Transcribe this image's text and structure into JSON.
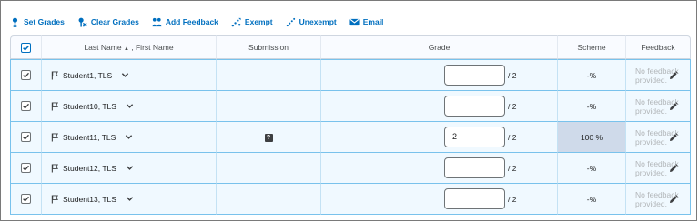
{
  "toolbar": {
    "set_grades": "Set Grades",
    "clear_grades": "Clear Grades",
    "add_feedback": "Add Feedback",
    "exempt": "Exempt",
    "unexempt": "Unexempt",
    "email": "Email"
  },
  "table": {
    "headers": {
      "name_prefix": "Last Name",
      "sort_arrow": "▲",
      "name_suffix": ", First Name",
      "submission": "Submission",
      "grade": "Grade",
      "scheme": "Scheme",
      "feedback": "Feedback"
    },
    "rows": [
      {
        "name": "Student1, TLS",
        "grade": "",
        "out_of": "/ 2",
        "scheme": "-%",
        "feedback": "No feedback provided.",
        "has_submission": false
      },
      {
        "name": "Student10, TLS",
        "grade": "",
        "out_of": "/ 2",
        "scheme": "-%",
        "feedback": "No feedback provided.",
        "has_submission": false
      },
      {
        "name": "Student11, TLS",
        "grade": "2",
        "out_of": "/ 2",
        "scheme": "100 %",
        "feedback": "No feedback provided.",
        "has_submission": true,
        "submission_icon": "?"
      },
      {
        "name": "Student12, TLS",
        "grade": "",
        "out_of": "/ 2",
        "scheme": "-%",
        "feedback": "No feedback provided.",
        "has_submission": false
      },
      {
        "name": "Student13, TLS",
        "grade": "",
        "out_of": "/ 2",
        "scheme": "-%",
        "feedback": "No feedback provided.",
        "has_submission": false
      }
    ]
  },
  "colors": {
    "link": "#006fbf",
    "row_bg": "#f0f9ff",
    "row_border": "#79c2ec",
    "scheme_highlight": "#cfdaea"
  }
}
